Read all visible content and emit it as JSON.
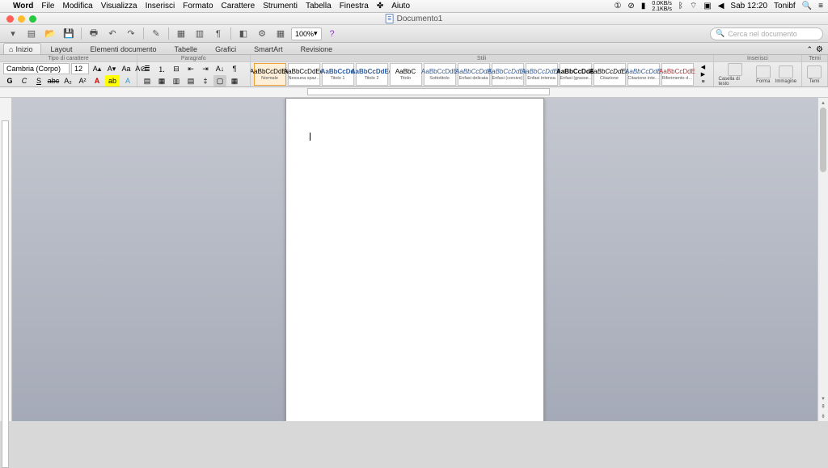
{
  "menubar": {
    "app": "Word",
    "items": [
      "File",
      "Modifica",
      "Visualizza",
      "Inserisci",
      "Formato",
      "Carattere",
      "Strumenti",
      "Tabella",
      "Finestra",
      "Aiuto"
    ],
    "stats_up": "0.0KB/s",
    "stats_down": "2.1KB/s",
    "clock": "Sab 12:20",
    "user": "Tonibf"
  },
  "window": {
    "title": "Documento1"
  },
  "qat": {
    "zoom": "100%"
  },
  "search": {
    "placeholder": "Cerca nel documento"
  },
  "tabs": [
    "Inizio",
    "Layout",
    "Elementi documento",
    "Tabelle",
    "Grafici",
    "SmartArt",
    "Revisione"
  ],
  "ribbon": {
    "group_font": "Tipo di carattere",
    "group_para": "Paragrafo",
    "group_styles": "Stili",
    "group_insert": "Inserisci",
    "group_themes": "Temi",
    "font_name": "Cambria (Corpo)",
    "font_size": "12",
    "styles": [
      {
        "preview": "AaBbCcDdEe",
        "name": "Normale",
        "sel": true,
        "cls": ""
      },
      {
        "preview": "AaBbCcDdEe",
        "name": "Nessuna spaz…",
        "cls": ""
      },
      {
        "preview": "AaBbCcDd",
        "name": "Titolo 1",
        "cls": "blue bold9"
      },
      {
        "preview": "AaBbCcDdEe",
        "name": "Titolo 2",
        "cls": "blue bold9"
      },
      {
        "preview": "AaBbC",
        "name": "Titolo",
        "cls": ""
      },
      {
        "preview": "AaBbCcDdE",
        "name": "Sottotitolo",
        "cls": "blue"
      },
      {
        "preview": "AaBbCcDdE",
        "name": "Enfasi delicata",
        "cls": "blue italic"
      },
      {
        "preview": "AaBbCcDdEe",
        "name": "Enfasi (corsivo)",
        "cls": "blue italic"
      },
      {
        "preview": "AaBbCcDdEe",
        "name": "Enfasi intensa",
        "cls": "blue italic"
      },
      {
        "preview": "AaBbCcDdE",
        "name": "Enfasi (grasse…",
        "cls": "bold9"
      },
      {
        "preview": "AaBbCcDdEe",
        "name": "Citazione",
        "cls": "italic"
      },
      {
        "preview": "AaBbCcDdE",
        "name": "Citazione inte…",
        "cls": "blue italic"
      },
      {
        "preview": "AaBbCcDdE",
        "name": "Riferimento d…",
        "cls": "red"
      }
    ],
    "insert_items": [
      "Casella di testo",
      "Forma",
      "Immagine",
      "Temi"
    ]
  }
}
